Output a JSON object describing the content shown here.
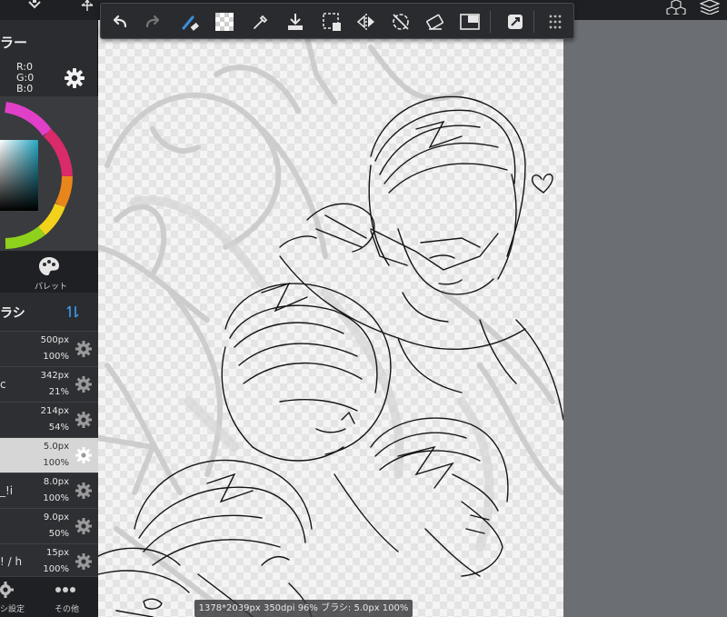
{
  "top_icons": [
    "cube-icon",
    "layers-icon",
    "move-icon",
    "select-icon"
  ],
  "toolbar": {
    "buttons": [
      "undo",
      "redo",
      "brush-eraser",
      "canvas-transparency",
      "eyedropper",
      "save-download",
      "selection-clear",
      "flip-horizontal",
      "rotate-reset",
      "eraser-toggle",
      "fullscreen",
      "edit-menu",
      "more-menu"
    ]
  },
  "color_panel": {
    "header": "ラー",
    "r": "R:0",
    "g": "G:0",
    "b": "B:0"
  },
  "palette_tab": {
    "label": "パレット"
  },
  "brush_panel": {
    "title": "ラシ",
    "brushes": [
      {
        "name": "",
        "size": "500px",
        "opacity": "100%",
        "selected": false
      },
      {
        "name": "c",
        "size": "342px",
        "opacity": "21%",
        "selected": false
      },
      {
        "name": "",
        "size": "214px",
        "opacity": "54%",
        "selected": false
      },
      {
        "name": "",
        "size": "5.0px",
        "opacity": "100%",
        "selected": true
      },
      {
        "name": "_!i",
        "size": "8.0px",
        "opacity": "100%",
        "selected": false
      },
      {
        "name": "",
        "size": "9.0px",
        "opacity": "50%",
        "selected": false
      },
      {
        "name": "! / h",
        "size": "15px",
        "opacity": "100%",
        "selected": false
      }
    ]
  },
  "bottom_bar": {
    "brush_settings_label": "シ設定",
    "more_label": "その他"
  },
  "status_bar": {
    "text": "1378*2039px 350dpi 96%  ブラシ: 5.0px 100%"
  },
  "colors": {
    "panel_bg": "#2b2c2f",
    "selected_row": "#d6d6d6",
    "accent_blue": "#3b8fd8",
    "workspace": "#6b6e73"
  }
}
